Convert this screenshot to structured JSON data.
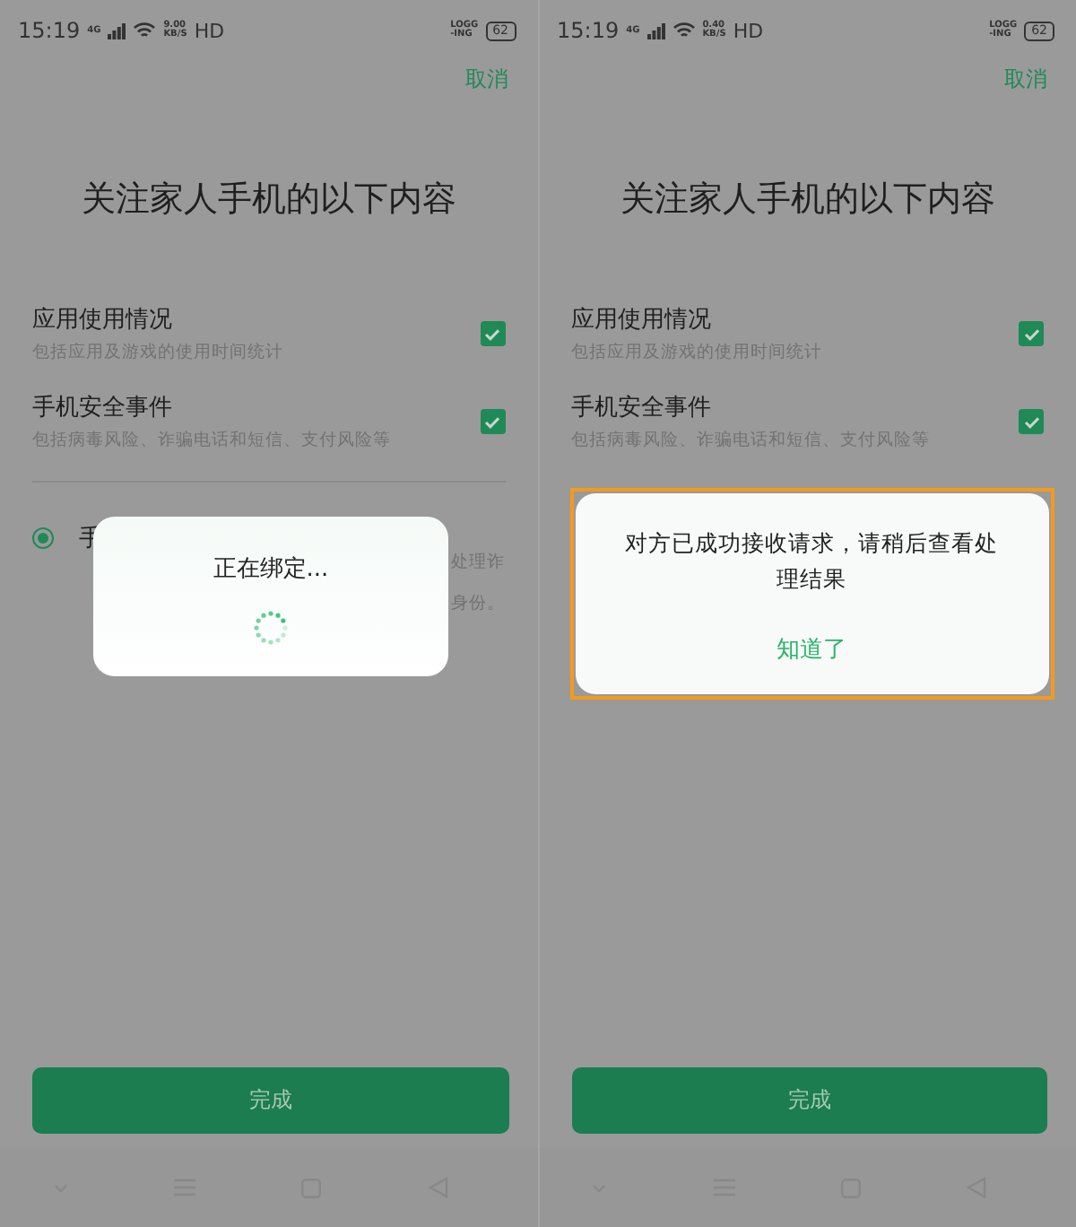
{
  "screens": [
    {
      "status_bar": {
        "time": "15:19",
        "network": "4G",
        "speed": [
          "9.00",
          "KB/S"
        ],
        "hd": "HD",
        "logging": [
          "LOGG",
          "-ING"
        ],
        "battery": "62"
      },
      "cancel": "取消",
      "title": "关注家人手机的以下内容",
      "items": [
        {
          "title": "应用使用情况",
          "subtitle": "包括应用及游戏的使用时间统计",
          "checked": true
        },
        {
          "title": "手机安全事件",
          "subtitle": "包括病毒风险、诈骗电话和短信、支付风险等",
          "checked": true
        }
      ],
      "option": {
        "selected": true,
        "title": "手",
        "description_fragments": [
          "处理诈",
          "身份。"
        ]
      },
      "dialog": {
        "kind": "loading",
        "message": "正在绑定..."
      },
      "done_button": "完成"
    },
    {
      "status_bar": {
        "time": "15:19",
        "network": "4G",
        "speed": [
          "0.40",
          "KB/S"
        ],
        "hd": "HD",
        "logging": [
          "LOGG",
          "-ING"
        ],
        "battery": "62"
      },
      "cancel": "取消",
      "title": "关注家人手机的以下内容",
      "items": [
        {
          "title": "应用使用情况",
          "subtitle": "包括应用及游戏的使用时间统计",
          "checked": true
        },
        {
          "title": "手机安全事件",
          "subtitle": "包括病毒风险、诈骗电话和短信、支付风险等",
          "checked": true
        }
      ],
      "dialog": {
        "kind": "alert",
        "message": "对方已成功接收请求，请稍后查看处理结果",
        "action": "知道了"
      },
      "done_button": "完成"
    }
  ]
}
